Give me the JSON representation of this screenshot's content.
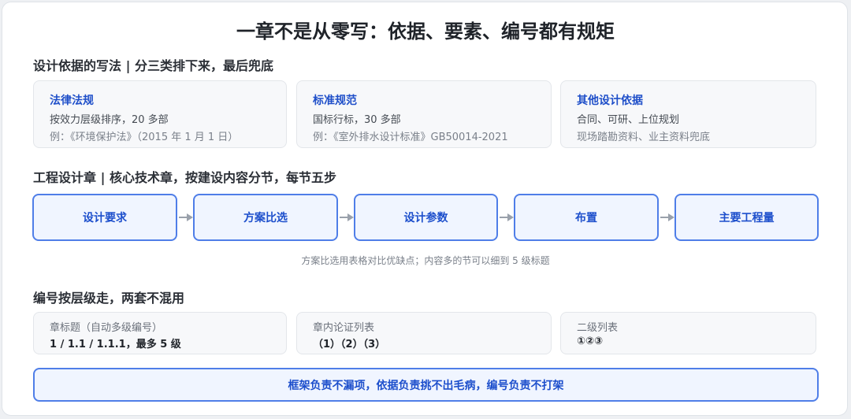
{
  "title": "一章不是从零写：依据、要素、编号都有规矩",
  "basis_section": {
    "heading": "设计依据的写法 | 分三类排下来，最后兜底",
    "cards": [
      {
        "title": "法律法规",
        "line1": "按效力层级排序，20 多部",
        "line2": "例：《环境保护法》（2015 年 1 月 1 日）"
      },
      {
        "title": "标准规范",
        "line1": "国标行标，30 多部",
        "line2": "例：《室外排水设计标准》GB50014-2021"
      },
      {
        "title": "其他设计依据",
        "line1": "合同、可研、上位规划",
        "line2": "现场踏勘资料、业主资料兜底"
      }
    ]
  },
  "design_section": {
    "heading": "工程设计章 | 核心技术章，按建设内容分节，每节五步",
    "steps": [
      "设计要求",
      "方案比选",
      "设计参数",
      "布置",
      "主要工程量"
    ],
    "note": "方案比选用表格对比优缺点；内容多的节可以细到 5 级标题"
  },
  "numbering_section": {
    "heading": "编号按层级走，两套不混用",
    "cards": [
      {
        "label": "章标题（自动多级编号）",
        "value": "1 / 1.1 / 1.1.1，最多 5 级"
      },
      {
        "label": "章内论证列表",
        "value": "（1）（2）（3）"
      },
      {
        "label": "二级列表",
        "value": "①②③"
      }
    ]
  },
  "footer": "框架负责不漏项，依据负责挑不出毛病，编号负责不打架",
  "colors": {
    "accent": "#4f7ee8",
    "accent_text": "#1d4fcc",
    "card_bg": "#f7f8fa"
  }
}
